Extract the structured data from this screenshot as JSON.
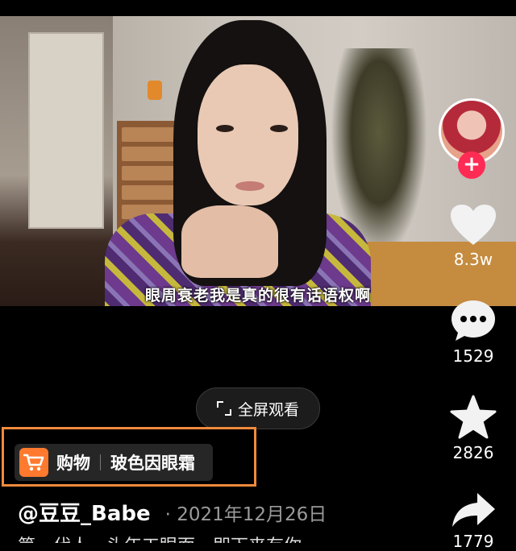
{
  "video": {
    "subtitle": "眼周衰老我是真的很有话语权啊"
  },
  "sidebar": {
    "like_count": "8.3w",
    "comment_count": "1529",
    "favorite_count": "2826",
    "share_count": "1779",
    "follow_symbol": "+"
  },
  "fullscreen_button": {
    "label": "全屏观看"
  },
  "shopping": {
    "label": "购物",
    "product": "玻色因眼霜",
    "accent_color": "#ff7a2e",
    "highlight_color": "#f08a3c"
  },
  "post": {
    "author": "@豆豆_Babe",
    "date": "· 2021年12月26日",
    "caption": "第一代人…头年工眼面…即下来有你"
  },
  "colors": {
    "follow": "#fe2c55",
    "background": "#000000"
  }
}
